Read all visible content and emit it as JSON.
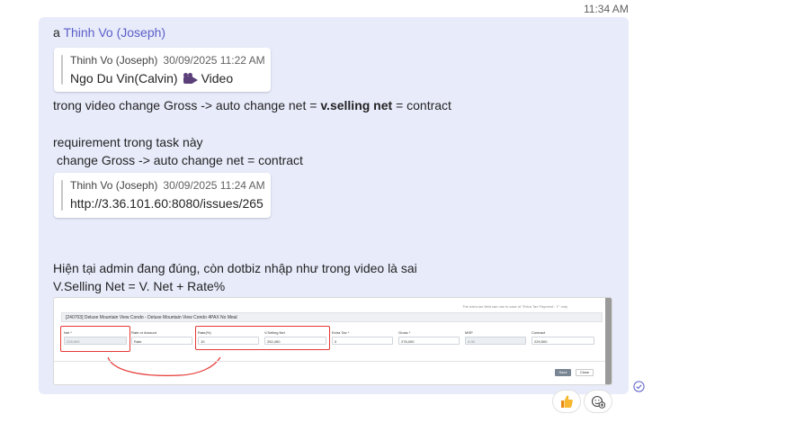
{
  "message": {
    "time": "11:34 AM",
    "mention_prefix": "a",
    "mention_name": "Thinh Vo (Joseph)",
    "quote1": {
      "author": "Thinh Vo (Joseph)",
      "time": "30/09/2025 11:22 AM",
      "text": "Ngo Du Vin(Calvin)",
      "attachment": "Video"
    },
    "line1_before": "trong video change Gross -> auto change net =",
    "line1_bold": "v.selling net",
    "line1_after": "= contract",
    "line2": "requirement trong task này",
    "line3": "change Gross -> auto change net = contract",
    "quote2": {
      "author": "Thinh Vo (Joseph)",
      "time": "30/09/2025 11:24 AM",
      "text": "http://3.36.101.60:8080/issues/265"
    },
    "line4": "Hiện tại admin đang đúng, còn dotbiz nhập như trong video là sai",
    "line5": "V.Selling Net = V. Net + Rate%"
  },
  "screenshot": {
    "note": "The extra tax field can use in case of \"Extra Tax Payment : Y\" only",
    "title": "[240703] Deluxe Mountain View Condo - Deluxe Mountain View Condo 4PAX No Meal",
    "labels": {
      "net": "Net *",
      "rate_or_amount": "Rate or Amount",
      "rate": "Rate(%)",
      "v_selling_net": "V.Selling Net",
      "extra_tax": "Extra Tax *",
      "gross": "Gross *",
      "msp": "MSP",
      "contract": "Contract"
    },
    "values": {
      "net": "228,900",
      "rate_or_amount": "Rate",
      "rate": "10",
      "v_selling_net": "252,450",
      "extra_tax": "0",
      "gross": "276,000",
      "msp": "0.00",
      "contract": "229,500"
    },
    "buttons": {
      "save": "Save",
      "close": "Close"
    }
  },
  "reactions": {
    "like": "like-emoji-icon",
    "add": "add-reaction-icon"
  },
  "colors": {
    "bubble": "#e8ebfa",
    "mention": "#5b5fc7",
    "highlight": "#e53935"
  }
}
